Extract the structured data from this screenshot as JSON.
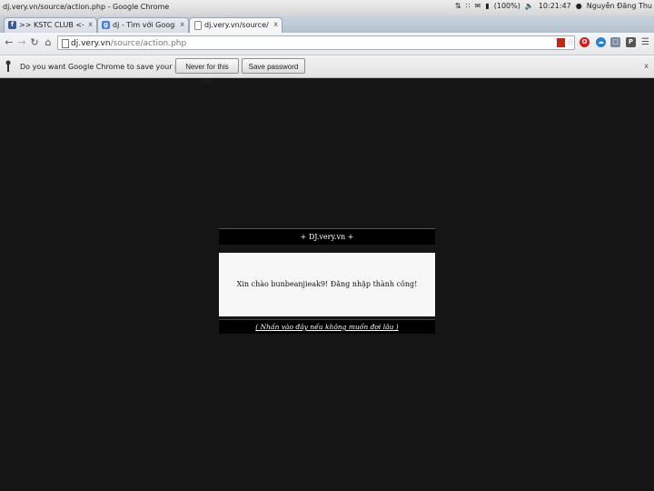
{
  "window": {
    "title": "dj.very.vn/source/action.php - Google Chrome"
  },
  "system_tray": {
    "battery": "(100%)",
    "time": "10:21:47",
    "user": "Nguyễn Đăng Thu"
  },
  "tabs": [
    {
      "label": ">> KSTC CLUB <<",
      "icon": "facebook-icon",
      "active": false
    },
    {
      "label": "dj - Tìm với Google",
      "icon": "google-icon",
      "active": false
    },
    {
      "label": "dj.very.vn/source/action...",
      "icon": "page-icon",
      "active": true
    }
  ],
  "tab_close": "x",
  "omnibox": {
    "host": "dj.very.vn",
    "path": "/source/action.php"
  },
  "infobar": {
    "message": "Do you want Google Chrome to save your passwo...",
    "never_label": "Never for this site",
    "save_label": "Save password",
    "close": "x"
  },
  "page": {
    "header": "+ DJ.very.vn +",
    "greeting": "Xin chào bunbeanjieak9! Đăng nhập thành công!",
    "footer_link": "( Nhấn vào đây nếu không muốn đợi lâu )"
  },
  "colors": {
    "page_bg": "#151515",
    "panel_bar": "#000000",
    "panel_body": "#f7f7f7"
  }
}
